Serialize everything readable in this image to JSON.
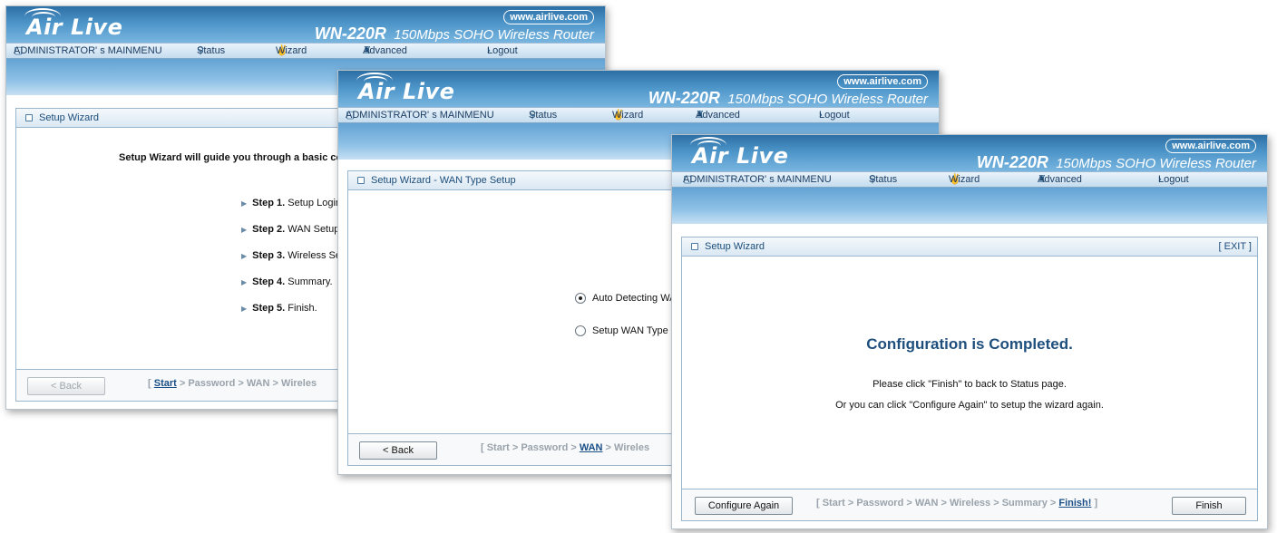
{
  "brand": {
    "logo": "Air Live",
    "url": "www.airlive.com",
    "model": "WN-220R",
    "model_desc": "150Mbps SOHO Wireless Router"
  },
  "nav": {
    "main": "ADMINISTRATOR' s MAINMENU",
    "status": "Status",
    "wizard": "Wizard",
    "advanced": "Advanced",
    "logout": "Logout"
  },
  "win1": {
    "title": "Setup Wizard",
    "intro": "Setup Wizard will guide you through a basic conf",
    "steps": [
      {
        "num": "Step 1.",
        "text": " Setup Login P"
      },
      {
        "num": "Step 2.",
        "text": " WAN Setup."
      },
      {
        "num": "Step 3.",
        "text": " Wireless Setu"
      },
      {
        "num": "Step 4.",
        "text": " Summary."
      },
      {
        "num": "Step 5.",
        "text": " Finish."
      }
    ],
    "back": "< Back",
    "crumb_open": "[ ",
    "crumb_current": "Start",
    "crumb_rest": " > Password > WAN > Wireles"
  },
  "win2": {
    "title": "Setup Wizard - WAN Type Setup",
    "option1": "Auto Detecting WAI",
    "option2": "Setup WAN Type M",
    "back": "< Back",
    "crumb_pre": "[ Start > Password > ",
    "crumb_current": "WAN",
    "crumb_rest": " > Wireles"
  },
  "win3": {
    "title": "Setup Wizard",
    "exit": "[ EXIT ]",
    "heading": "Configuration is Completed.",
    "line1": "Please click \"Finish\" to back to Status page.",
    "line2": "Or you can click \"Configure Again\" to setup the wizard again.",
    "configure_again": "Configure Again",
    "finish": "Finish",
    "crumb_pre": "[ Start > Password > WAN > Wireless > Summary > ",
    "crumb_current": "Finish!",
    "crumb_post": " ]"
  }
}
